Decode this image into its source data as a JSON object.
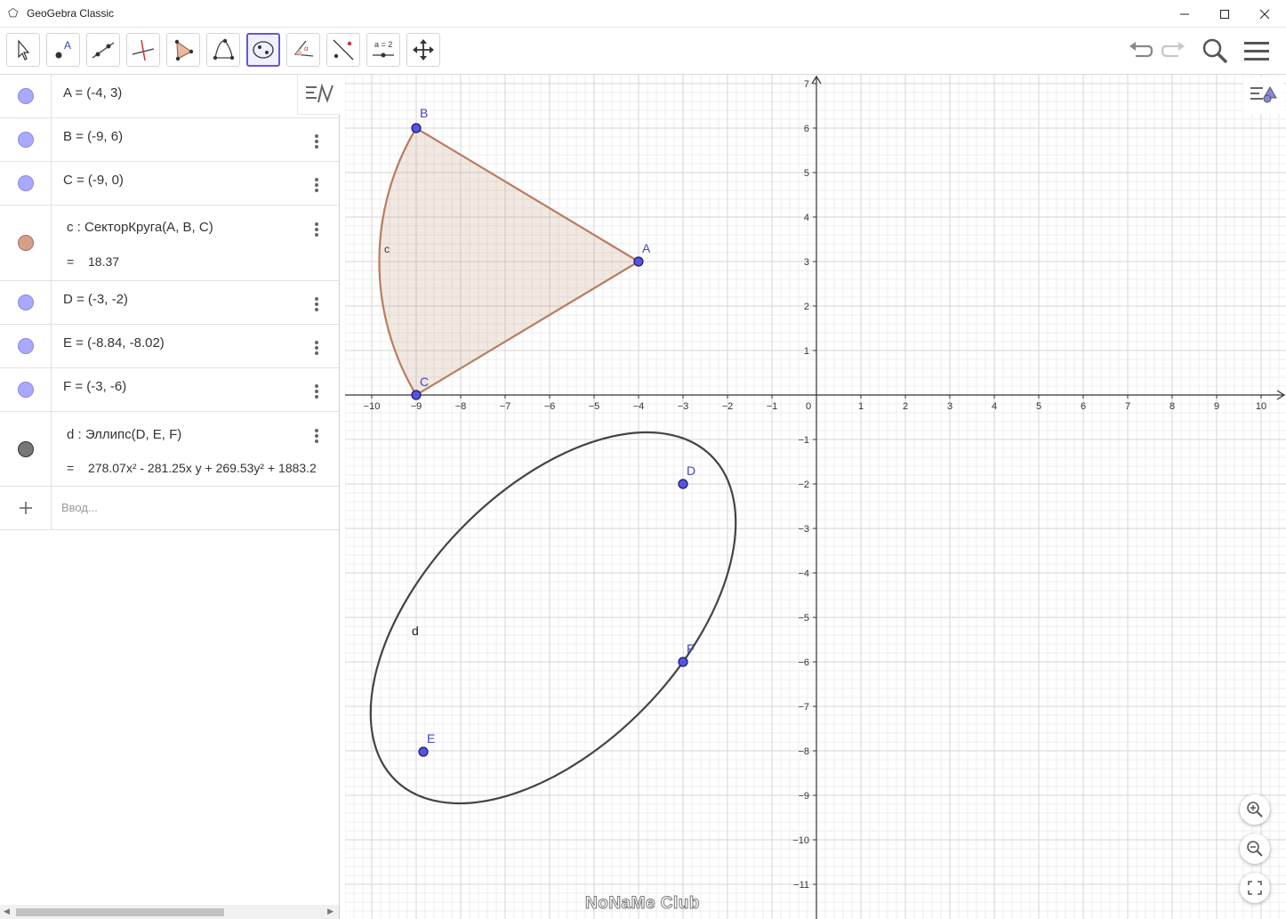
{
  "window": {
    "title": "GeoGebra Classic"
  },
  "toolbar": {
    "tools": [
      {
        "name": "move-tool",
        "icon": "arrow-cursor-icon"
      },
      {
        "name": "point-tool",
        "icon": "point-a-icon"
      },
      {
        "name": "line-tool",
        "icon": "line-icon"
      },
      {
        "name": "perpendicular-tool",
        "icon": "perpendicular-icon"
      },
      {
        "name": "polygon-tool",
        "icon": "polygon-icon"
      },
      {
        "name": "circle-tool",
        "icon": "circle-three-points-icon"
      },
      {
        "name": "ellipse-tool",
        "icon": "ellipse-icon",
        "active": true
      },
      {
        "name": "angle-tool",
        "icon": "angle-icon"
      },
      {
        "name": "reflect-tool",
        "icon": "reflect-icon"
      },
      {
        "name": "slider-tool",
        "icon": "slider-icon",
        "label": "a = 2"
      },
      {
        "name": "move-graphics-tool",
        "icon": "move-arrows-icon"
      }
    ]
  },
  "algebra": {
    "rows": [
      {
        "id": "A",
        "def": "A = (-4, 3)",
        "color": "#a9a9ff"
      },
      {
        "id": "B",
        "def": "B = (-9, 6)",
        "color": "#a9a9ff"
      },
      {
        "id": "C",
        "def": "C = (-9, 0)",
        "color": "#a9a9ff"
      },
      {
        "id": "c",
        "def": "c : СекторКруга(A, B, C)",
        "value": "18.37",
        "color": "#d4a08a"
      },
      {
        "id": "D",
        "def": "D = (-3, -2)",
        "color": "#a9a9ff"
      },
      {
        "id": "E",
        "def": "E = (-8.84, -8.02)",
        "color": "#a9a9ff"
      },
      {
        "id": "F",
        "def": "F = (-3, -6)",
        "color": "#a9a9ff"
      },
      {
        "id": "d",
        "def": "d : Эллипс(D, E, F)",
        "value": "278.07x² - 281.25x y + 269.53y² + 1883.2",
        "color": "#777777"
      }
    ],
    "input_placeholder": "Ввод..."
  },
  "graphics": {
    "x_ticks": [
      "−10",
      "−9",
      "−8",
      "−7",
      "−6",
      "−5",
      "−4",
      "−3",
      "−2",
      "−1",
      "0",
      "1",
      "2",
      "3",
      "4",
      "5",
      "6",
      "7",
      "8",
      "9",
      "10"
    ],
    "y_ticks": [
      "7",
      "6",
      "5",
      "4",
      "3",
      "2",
      "1",
      "−1",
      "−2",
      "−3",
      "−4",
      "−5",
      "−6",
      "−7",
      "−8",
      "−9",
      "−10",
      "−11"
    ],
    "points": [
      {
        "label": "A",
        "x": -4,
        "y": 3
      },
      {
        "label": "B",
        "x": -9,
        "y": 6
      },
      {
        "label": "C",
        "x": -9,
        "y": 0
      },
      {
        "label": "D",
        "x": -3,
        "y": -2
      },
      {
        "label": "E",
        "x": -8.84,
        "y": -8.02
      },
      {
        "label": "F",
        "x": -3,
        "y": -6
      }
    ],
    "sector_label": "c",
    "ellipse_label": "d",
    "sector_color": "#b87d5e",
    "point_color": "#5555e0"
  },
  "watermark": "NoNaMe Club"
}
